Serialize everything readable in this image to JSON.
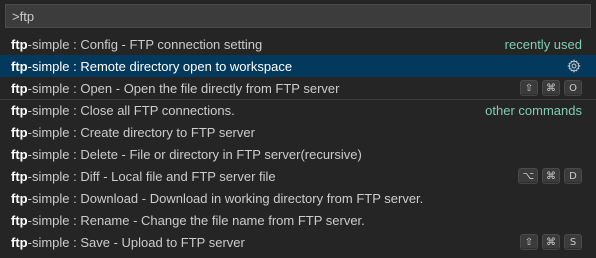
{
  "input": {
    "value": ">ftp"
  },
  "items": [
    {
      "prefix": "ftp",
      "rest": "-simple : Config - FTP connection setting",
      "group": "recently used"
    },
    {
      "prefix": "ftp",
      "rest": "-simple : Remote directory open to workspace",
      "icon": "gear-icon"
    },
    {
      "prefix": "ftp",
      "rest": "-simple : Open - Open the file directly from FTP server",
      "keys": [
        "⇧",
        "⌘",
        "O"
      ]
    },
    {
      "prefix": "ftp",
      "rest": "-simple : Close all FTP connections.",
      "group": "other commands"
    },
    {
      "prefix": "ftp",
      "rest": "-simple : Create directory to FTP server"
    },
    {
      "prefix": "ftp",
      "rest": "-simple : Delete - File or directory in FTP server(recursive)"
    },
    {
      "prefix": "ftp",
      "rest": "-simple : Diff - Local file and FTP server file",
      "keys": [
        "⌥",
        "⌘",
        "D"
      ]
    },
    {
      "prefix": "ftp",
      "rest": "-simple : Download - Download in working directory from FTP server."
    },
    {
      "prefix": "ftp",
      "rest": "-simple : Rename - Change the file name from FTP server."
    },
    {
      "prefix": "ftp",
      "rest": "-simple : Save - Upload to FTP server",
      "keys": [
        "⇧",
        "⌘",
        "S"
      ]
    }
  ],
  "colors": {
    "background": "#252526",
    "input_background": "#3c3c3c",
    "selected_row": "#04395e",
    "group_label": "#75beff"
  }
}
